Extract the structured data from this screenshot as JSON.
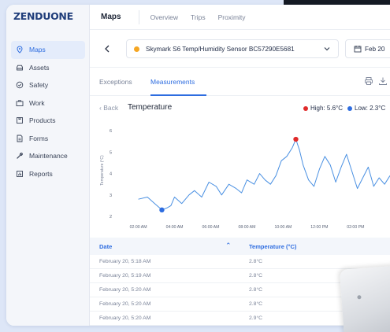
{
  "app": {
    "logo": "ZENDUONE",
    "section": "Maps"
  },
  "sidebar": {
    "items": [
      {
        "label": "Maps",
        "icon": "location-pin-icon",
        "active": true
      },
      {
        "label": "Assets",
        "icon": "car-icon"
      },
      {
        "label": "Safety",
        "icon": "shield-check-icon"
      },
      {
        "label": "Work",
        "icon": "briefcase-icon"
      },
      {
        "label": "Products",
        "icon": "box-icon"
      },
      {
        "label": "Forms",
        "icon": "document-icon"
      },
      {
        "label": "Maintenance",
        "icon": "wrench-icon"
      },
      {
        "label": "Reports",
        "icon": "chart-icon"
      }
    ]
  },
  "topbar": {
    "links": [
      "Overview",
      "Trips",
      "Proximity"
    ]
  },
  "selector": {
    "back_icon": "chevron-left-icon",
    "sensor": "Skymark S6 Temp/Humidity Sensor BC57290E5681",
    "sensor_status_color": "#f5a623",
    "date": "Feb 20"
  },
  "tabs": {
    "items": [
      "Exceptions",
      "Measurements"
    ],
    "active": "Measurements"
  },
  "chart_header": {
    "back": "‹ Back",
    "title": "Temperature",
    "high": "High: 5.6°C",
    "low": "Low: 2.3°C",
    "high_color": "#e02b2b",
    "low_color": "#2e6de0"
  },
  "chart_data": {
    "type": "line",
    "ylabel": "Temperature (°C)",
    "yticks": [
      2,
      3,
      4,
      5,
      6
    ],
    "ylim": [
      2,
      6.3
    ],
    "xticks": [
      "02:00 AM",
      "04:00 AM",
      "06:00 AM",
      "08:00 AM",
      "10:00 AM",
      "12:00 PM",
      "02:00 PM"
    ],
    "x_hours": [
      0.0,
      0.5,
      0.9,
      1.3,
      1.6,
      1.8,
      2.0,
      2.4,
      2.8,
      3.1,
      3.5,
      3.9,
      4.3,
      4.6,
      5.0,
      5.4,
      5.7,
      6.0,
      6.4,
      6.7,
      7.0,
      7.3,
      7.6,
      7.9,
      8.2,
      8.5,
      8.7,
      8.9,
      9.1,
      9.4,
      9.7,
      10.0,
      10.3,
      10.6,
      10.9,
      11.2,
      11.5,
      11.8,
      12.1,
      12.4,
      12.7,
      13.0,
      13.3,
      13.6,
      13.9
    ],
    "values": [
      2.8,
      2.9,
      2.6,
      2.3,
      2.4,
      2.5,
      2.9,
      2.6,
      3.0,
      3.2,
      2.9,
      3.6,
      3.4,
      3.0,
      3.5,
      3.3,
      3.1,
      3.7,
      3.5,
      4.0,
      3.7,
      3.5,
      3.9,
      4.6,
      4.8,
      5.2,
      5.6,
      5.1,
      4.4,
      3.7,
      3.4,
      4.2,
      4.8,
      4.4,
      3.6,
      4.3,
      4.9,
      4.1,
      3.3,
      3.8,
      4.3,
      3.4,
      3.8,
      3.5,
      3.9
    ],
    "high_marker": {
      "x_hours": 8.7,
      "value": 5.6
    },
    "low_marker": {
      "x_hours": 1.3,
      "value": 2.3
    },
    "line_color": "#4a90e2",
    "grid": false
  },
  "table": {
    "columns": [
      "Date",
      "Temperature (°C)"
    ],
    "rows": [
      [
        "February 20, 5:18 AM",
        "2.8°C"
      ],
      [
        "February 20, 5:19 AM",
        "2.8°C"
      ],
      [
        "February 20, 5:20 AM",
        "2.8°C"
      ],
      [
        "February 20, 5:20 AM",
        "2.8°C"
      ],
      [
        "February 20, 5:20 AM",
        "2.9°C"
      ]
    ]
  }
}
